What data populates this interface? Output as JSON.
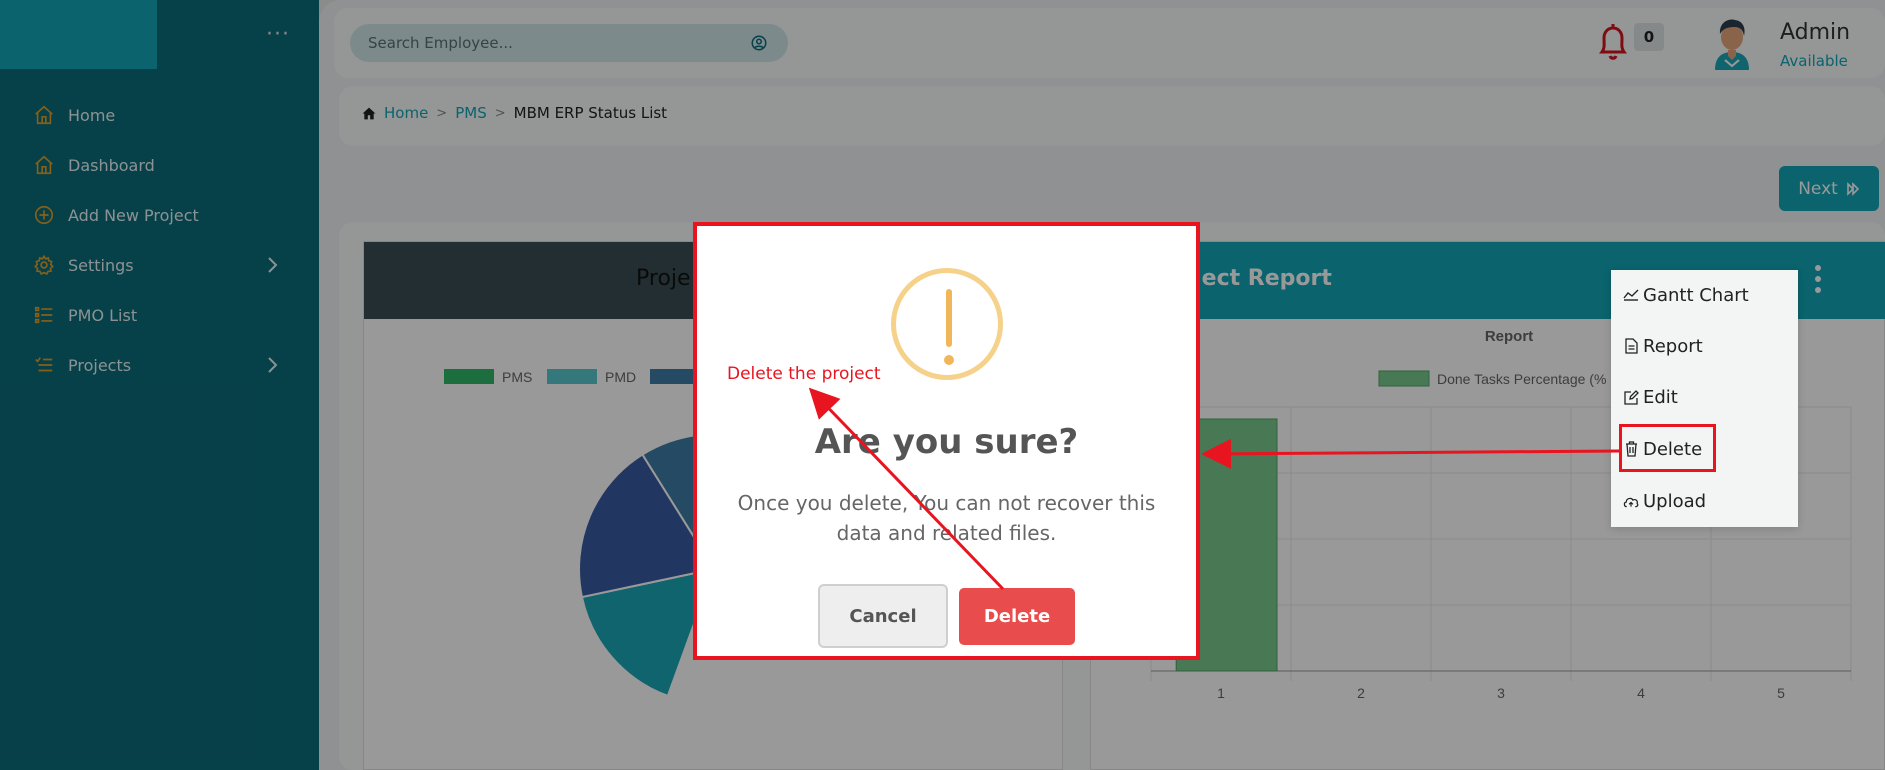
{
  "sidebar": {
    "items": [
      {
        "label": "Home",
        "icon": "home-icon"
      },
      {
        "label": "Dashboard",
        "icon": "home-icon"
      },
      {
        "label": "Add New Project",
        "icon": "plus-circle-icon"
      },
      {
        "label": "Settings",
        "icon": "gear-icon",
        "has_submenu": true
      },
      {
        "label": "PMO List",
        "icon": "list-icon"
      },
      {
        "label": "Projects",
        "icon": "list-icon",
        "has_submenu": true
      }
    ]
  },
  "header": {
    "search_placeholder": "Search Employee...",
    "notification_count": "0",
    "user_name": "Admin",
    "user_status": "Available"
  },
  "breadcrumb": {
    "home": "Home",
    "pms": "PMS",
    "current": "MBM ERP Status List"
  },
  "toolbar": {
    "next_label": "Next"
  },
  "left_panel": {
    "title": "Proje",
    "legend": [
      "PMS",
      "PMD"
    ]
  },
  "right_panel": {
    "title": "oject Report",
    "chart_title": "Report",
    "legend": "Done Tasks Percentage (%"
  },
  "chart_data": [
    {
      "type": "pie",
      "legend": [
        "PMS",
        "PMD"
      ],
      "colors": [
        "#1aa7b8",
        "#3a5ba3",
        "#3c7ea6",
        "#5bb1c4"
      ]
    },
    {
      "type": "bar",
      "title": "Report",
      "categories": [
        "1",
        "2",
        "3",
        "4",
        "5"
      ],
      "series": [
        {
          "name": "Done Tasks Percentage (%",
          "values": [
            100,
            null,
            null,
            null,
            null
          ],
          "color": "#79c88c"
        }
      ]
    }
  ],
  "context_menu": {
    "items": [
      "Gantt Chart",
      "Report",
      "Edit",
      "Delete",
      "Upload"
    ]
  },
  "modal": {
    "title": "Are you sure?",
    "message_line1": "Once you delete, You can not recover this",
    "message_line2": "data and related files.",
    "cancel_label": "Cancel",
    "delete_label": "Delete"
  },
  "annotation": {
    "note": "Delete the project",
    "color": "#e8141f"
  }
}
